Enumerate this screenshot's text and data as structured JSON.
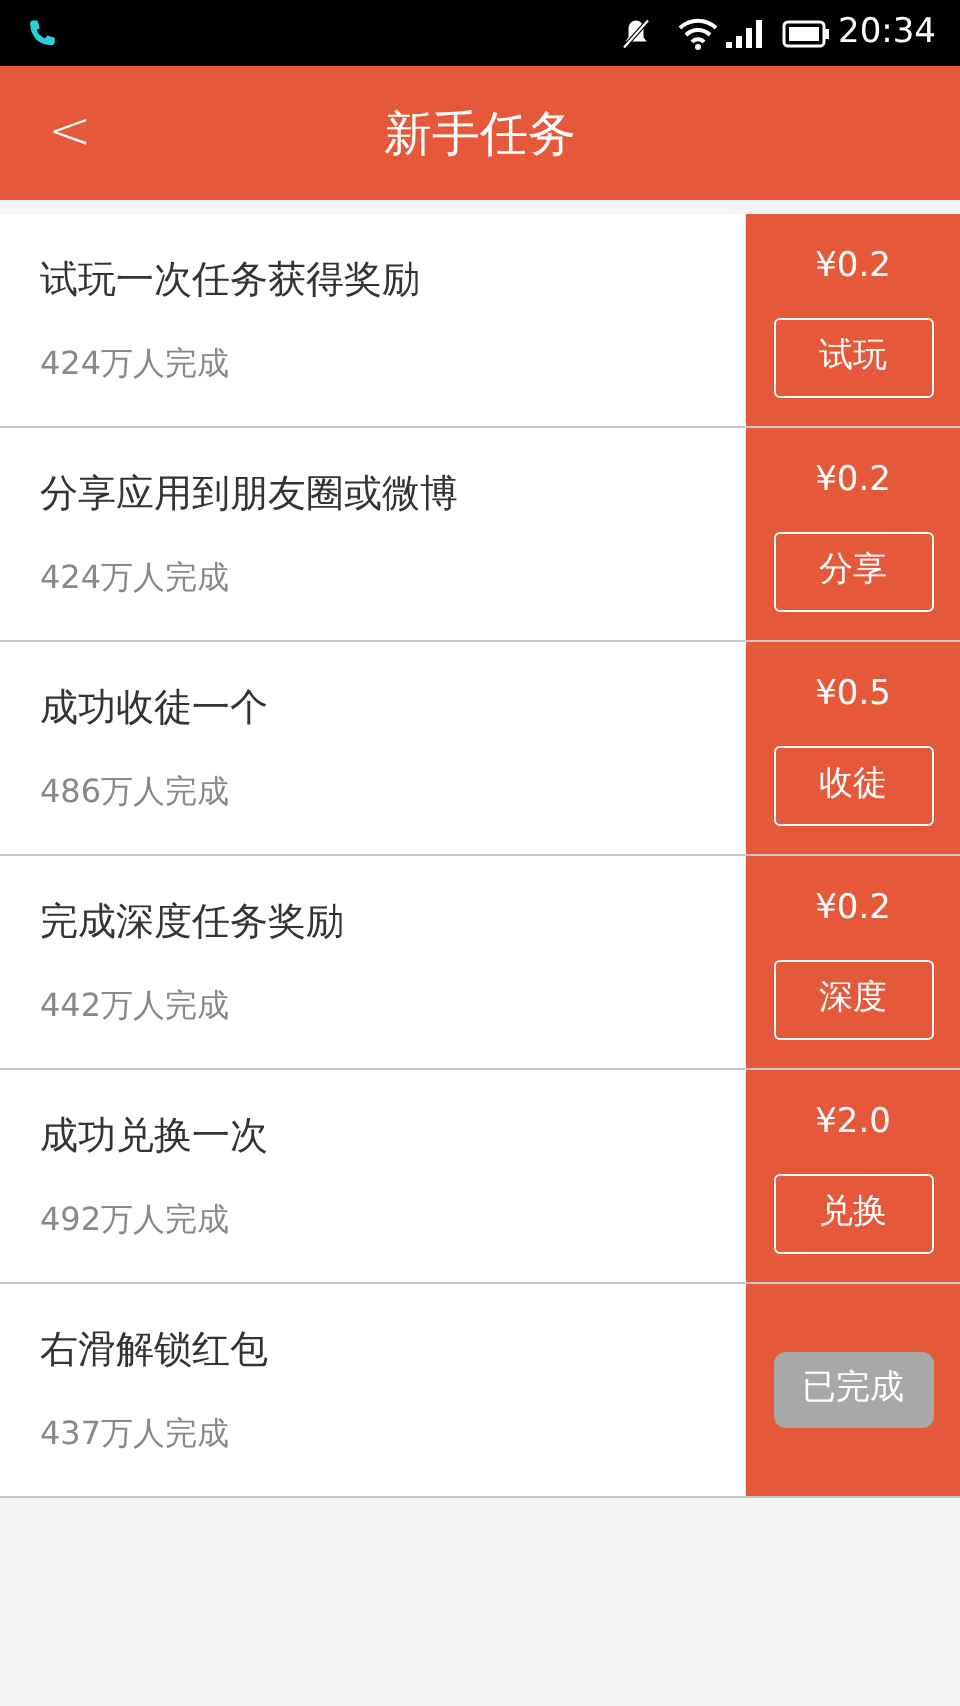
{
  "status_bar": {
    "time": "20:34"
  },
  "header": {
    "back": "<",
    "title": "新手任务"
  },
  "tasks": [
    {
      "title": "试玩一次任务获得奖励",
      "count": "424万人完成",
      "reward": "¥0.2",
      "action": "试玩",
      "completed": false
    },
    {
      "title": "分享应用到朋友圈或微博",
      "count": "424万人完成",
      "reward": "¥0.2",
      "action": "分享",
      "completed": false
    },
    {
      "title": "成功收徒一个",
      "count": "486万人完成",
      "reward": "¥0.5",
      "action": "收徒",
      "completed": false
    },
    {
      "title": "完成深度任务奖励",
      "count": "442万人完成",
      "reward": "¥0.2",
      "action": "深度",
      "completed": false
    },
    {
      "title": "成功兑换一次",
      "count": "492万人完成",
      "reward": "¥2.0",
      "action": "兑换",
      "completed": false
    },
    {
      "title": "右滑解锁红包",
      "count": "437万人完成",
      "action": "已完成",
      "completed": true
    }
  ]
}
